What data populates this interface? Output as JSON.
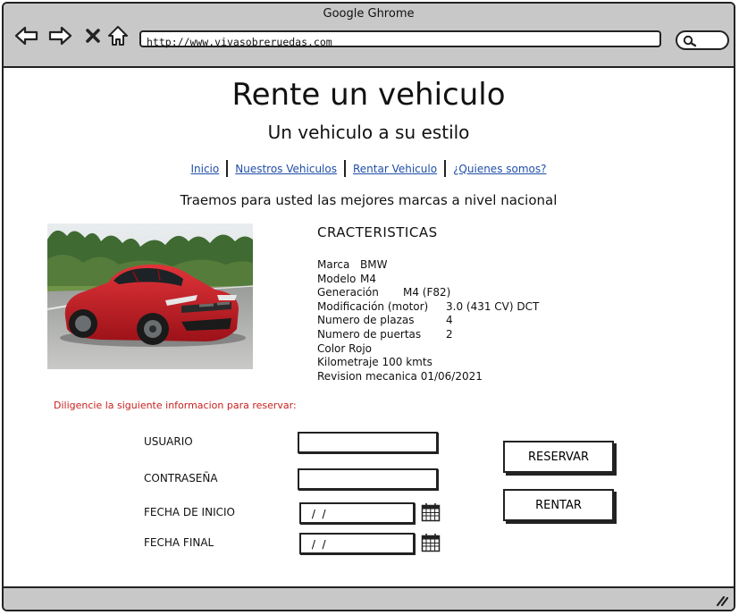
{
  "browser": {
    "title": "Google Ghrome",
    "url": "http://www.vivasobreruedas.com",
    "icons": [
      "back-arrow-icon",
      "forward-arrow-icon",
      "close-x-icon",
      "home-icon",
      "search-icon"
    ]
  },
  "header": {
    "title": "Rente un vehiculo",
    "subtitle": "Un vehiculo a su estilo"
  },
  "nav": {
    "items": [
      {
        "label": "Inicio"
      },
      {
        "label": "Nuestros Vehiculos"
      },
      {
        "label": "Rentar Vehiculo"
      },
      {
        "label": "¿Quienes somos?"
      }
    ]
  },
  "tagline": "Traemos para usted las mejores marcas a nivel nacional",
  "specs": {
    "title": "CRACTERISTICAS",
    "rows": [
      {
        "key": "Marca",
        "value": "BMW"
      },
      {
        "key": "Modelo",
        "value": "M4"
      },
      {
        "key": "Generación",
        "value": "M4 (F82)"
      },
      {
        "key": "Modificación (motor)",
        "value": "3.0 (431 CV) DCT"
      },
      {
        "key": "Numero de plazas",
        "value": "4"
      },
      {
        "key": "Numero de puertas",
        "value": "2"
      },
      {
        "key": "Color",
        "value": "Rojo"
      },
      {
        "key": "Kilometraje",
        "value": "100 kmts"
      },
      {
        "key": "Revision mecanica",
        "value": "01/06/2021"
      }
    ]
  },
  "form": {
    "instruction": "Diligencie la siguiente informacion para reservar:",
    "usuario_label": "USUARIO",
    "usuario_value": "",
    "password_label": "CONTRASEÑA",
    "password_value": "",
    "start_label": "FECHA DE INICIO",
    "start_value": " /  /",
    "end_label": "FECHA FINAL",
    "end_value": " /  /",
    "reserve_button": "RESERVAR",
    "rent_button": "RENTAR"
  },
  "colors": {
    "link": "#1f4fa8",
    "instruction": "#c8201f",
    "car": "#c8202a"
  }
}
